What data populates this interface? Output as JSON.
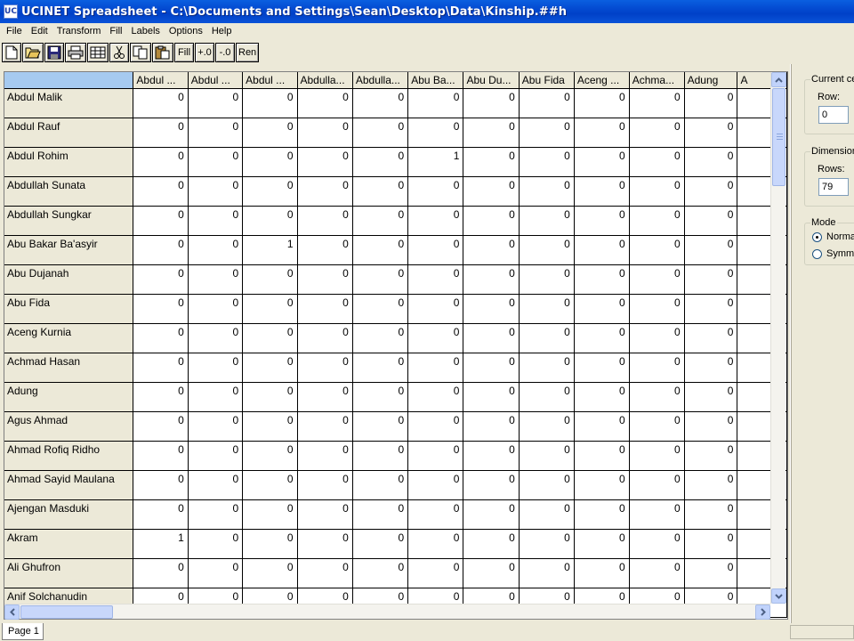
{
  "window": {
    "icon_label": "UC",
    "title": "UCINET Spreadsheet - C:\\Documents and Settings\\Sean\\Desktop\\Data\\Kinship.##h"
  },
  "menu": [
    "File",
    "Edit",
    "Transform",
    "Fill",
    "Labels",
    "Options",
    "Help"
  ],
  "toolbar": {
    "icons": [
      "new-file-icon",
      "open-folder-icon",
      "save-disk-icon",
      "print-icon",
      "grid-view-icon",
      "cut-scissors-icon",
      "copy-icon",
      "paste-icon"
    ],
    "fill_label": "Fill",
    "plus_zero_label": "+.0",
    "minus_zero_label": "-.0",
    "ren_label": "Ren"
  },
  "grid": {
    "columns": [
      "Abdul ...",
      "Abdul ...",
      "Abdul ...",
      "Abdulla...",
      "Abdulla...",
      "Abu Ba...",
      "Abu Du...",
      "Abu Fida",
      "Aceng ...",
      "Achma...",
      "Adung",
      "A"
    ],
    "rows": [
      {
        "label": "Abdul Malik",
        "values": [
          "0",
          "0",
          "0",
          "0",
          "0",
          "0",
          "0",
          "0",
          "0",
          "0",
          "0"
        ]
      },
      {
        "label": "Abdul Rauf",
        "values": [
          "0",
          "0",
          "0",
          "0",
          "0",
          "0",
          "0",
          "0",
          "0",
          "0",
          "0"
        ]
      },
      {
        "label": "Abdul Rohim",
        "values": [
          "0",
          "0",
          "0",
          "0",
          "0",
          "1",
          "0",
          "0",
          "0",
          "0",
          "0"
        ]
      },
      {
        "label": "Abdullah Sunata",
        "values": [
          "0",
          "0",
          "0",
          "0",
          "0",
          "0",
          "0",
          "0",
          "0",
          "0",
          "0"
        ]
      },
      {
        "label": "Abdullah Sungkar",
        "values": [
          "0",
          "0",
          "0",
          "0",
          "0",
          "0",
          "0",
          "0",
          "0",
          "0",
          "0"
        ]
      },
      {
        "label": "Abu Bakar Ba'asyir",
        "values": [
          "0",
          "0",
          "1",
          "0",
          "0",
          "0",
          "0",
          "0",
          "0",
          "0",
          "0"
        ]
      },
      {
        "label": "Abu Dujanah",
        "values": [
          "0",
          "0",
          "0",
          "0",
          "0",
          "0",
          "0",
          "0",
          "0",
          "0",
          "0"
        ]
      },
      {
        "label": "Abu Fida",
        "values": [
          "0",
          "0",
          "0",
          "0",
          "0",
          "0",
          "0",
          "0",
          "0",
          "0",
          "0"
        ]
      },
      {
        "label": "Aceng Kurnia",
        "values": [
          "0",
          "0",
          "0",
          "0",
          "0",
          "0",
          "0",
          "0",
          "0",
          "0",
          "0"
        ]
      },
      {
        "label": "Achmad Hasan",
        "values": [
          "0",
          "0",
          "0",
          "0",
          "0",
          "0",
          "0",
          "0",
          "0",
          "0",
          "0"
        ]
      },
      {
        "label": "Adung",
        "values": [
          "0",
          "0",
          "0",
          "0",
          "0",
          "0",
          "0",
          "0",
          "0",
          "0",
          "0"
        ]
      },
      {
        "label": "Agus Ahmad",
        "values": [
          "0",
          "0",
          "0",
          "0",
          "0",
          "0",
          "0",
          "0",
          "0",
          "0",
          "0"
        ]
      },
      {
        "label": "Ahmad Rofiq Ridho",
        "values": [
          "0",
          "0",
          "0",
          "0",
          "0",
          "0",
          "0",
          "0",
          "0",
          "0",
          "0"
        ]
      },
      {
        "label": "Ahmad Sayid Maulana",
        "values": [
          "0",
          "0",
          "0",
          "0",
          "0",
          "0",
          "0",
          "0",
          "0",
          "0",
          "0"
        ]
      },
      {
        "label": "Ajengan Masduki",
        "values": [
          "0",
          "0",
          "0",
          "0",
          "0",
          "0",
          "0",
          "0",
          "0",
          "0",
          "0"
        ]
      },
      {
        "label": "Akram",
        "values": [
          "1",
          "0",
          "0",
          "0",
          "0",
          "0",
          "0",
          "0",
          "0",
          "0",
          "0"
        ]
      },
      {
        "label": "Ali Ghufron",
        "values": [
          "0",
          "0",
          "0",
          "0",
          "0",
          "0",
          "0",
          "0",
          "0",
          "0",
          "0"
        ]
      },
      {
        "label": "Anif Solchanudin",
        "values": [
          "0",
          "0",
          "0",
          "0",
          "0",
          "0",
          "0",
          "0",
          "0",
          "0",
          "0"
        ]
      }
    ]
  },
  "side_panel": {
    "current_cell": {
      "legend": "Current ce",
      "row_label": "Row:",
      "row_value": "0"
    },
    "dimensions": {
      "legend": "Dimension",
      "rows_label": "Rows:",
      "rows_value": "79"
    },
    "mode": {
      "legend": "Mode",
      "normal_label": "Norma",
      "symmetric_label": "Symme",
      "selected": "normal"
    }
  },
  "sheet_tab": "Page 1",
  "colors": {
    "titlebar": "#0349d0",
    "corner_cell": "#a6caf0",
    "chrome": "#ece9d8"
  }
}
